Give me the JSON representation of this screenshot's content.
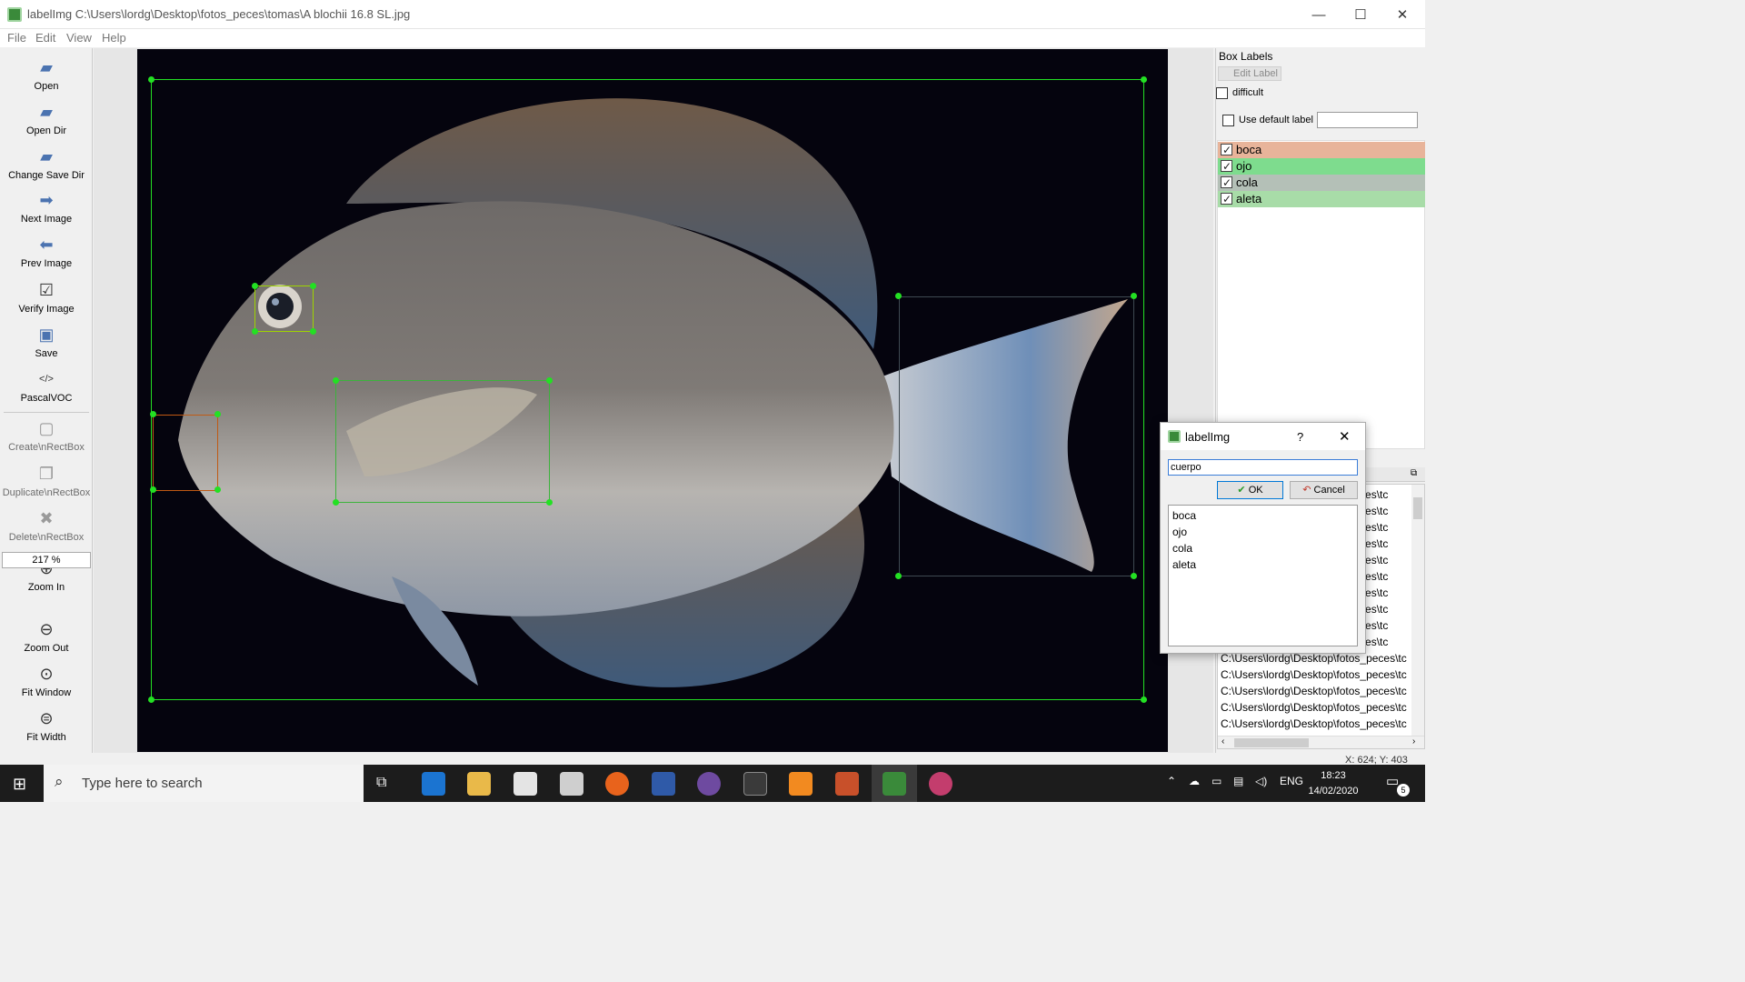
{
  "window": {
    "title": "labelImg C:\\Users\\lordg\\Desktop\\fotos_peces\\tomas\\A blochii 16.8 SL.jpg",
    "minimize": "—",
    "maximize": "☐",
    "close": "✕"
  },
  "menu": [
    "File",
    "Edit",
    "View",
    "Help"
  ],
  "toolbar": {
    "open": "Open",
    "open_dir": "Open Dir",
    "change_save_dir": "Change Save Dir",
    "next_image": "Next Image",
    "prev_image": "Prev Image",
    "verify_image": "Verify Image",
    "save": "Save",
    "format_icon": "</>",
    "format": "PascalVOC",
    "create_rect": "Create\\nRectBox",
    "duplicate_rect": "Duplicate\\nRectBox",
    "delete_rect": "Delete\\nRectBox",
    "zoom_in": "Zoom In",
    "zoom_value": "217 %",
    "zoom_out": "Zoom Out",
    "fit_window": "Fit Window",
    "fit_width": "Fit Width"
  },
  "box_labels": {
    "title": "Box Labels",
    "edit_label": "Edit Label",
    "difficult": "difficult",
    "use_default": "Use default label",
    "items": [
      {
        "name": "boca",
        "color": "#e8b49a",
        "checked": true
      },
      {
        "name": "ojo",
        "color": "#7edc8e",
        "checked": true
      },
      {
        "name": "cola",
        "color": "#b4c0b7",
        "checked": true
      },
      {
        "name": "aleta",
        "color": "#a8dca8",
        "checked": true
      }
    ]
  },
  "file_list": {
    "partial_rows": [
      "_peces\\tc",
      "_peces\\tc",
      "_peces\\tc",
      "_peces\\tc",
      "_peces\\tc",
      "_peces\\tc",
      "_peces\\tc",
      "_peces\\tc",
      "_peces\\tc",
      "_peces\\tc"
    ],
    "full_rows": [
      "C:\\Users\\lordg\\Desktop\\fotos_peces\\tc",
      "C:\\Users\\lordg\\Desktop\\fotos_peces\\tc",
      "C:\\Users\\lordg\\Desktop\\fotos_peces\\tc",
      "C:\\Users\\lordg\\Desktop\\fotos_peces\\tc",
      "C:\\Users\\lordg\\Desktop\\fotos_peces\\tc"
    ]
  },
  "dialog": {
    "title": "labelImg",
    "help": "?",
    "close": "✕",
    "input_value": "cuerpo",
    "ok": "OK",
    "cancel": "Cancel",
    "options": [
      "boca",
      "ojo",
      "cola",
      "aleta"
    ]
  },
  "status": "X: 624; Y: 403",
  "taskbar": {
    "search_placeholder": "Type here to search",
    "lang": "ENG",
    "time": "18:23",
    "date": "14/02/2020",
    "notifications": "5"
  },
  "colors": {
    "box_green": "#23e023",
    "box_orange": "#c05a14",
    "canvas_bg": "#05040e"
  }
}
